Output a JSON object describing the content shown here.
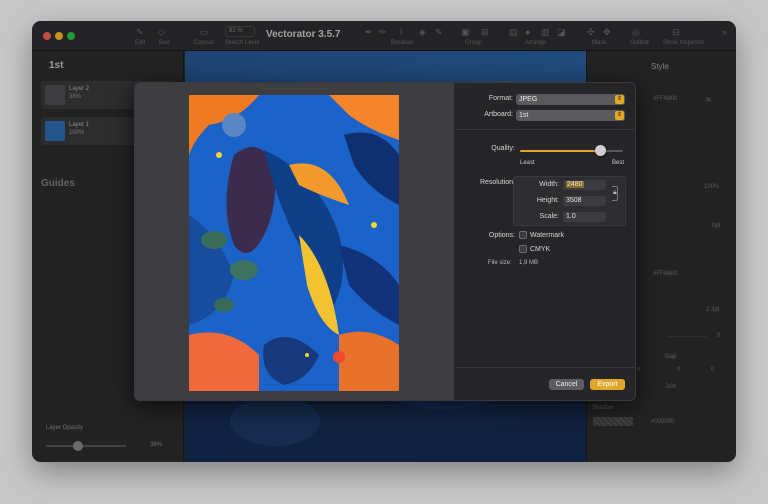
{
  "window": {
    "title": "Vectorator 3.5.7",
    "toolbar": {
      "zoom": "82 %",
      "labels": [
        "Edit",
        "Bed",
        "Canvas",
        "Sketch Level",
        "Boolean",
        "Group",
        "Arrange",
        "Mask",
        "Outline",
        "Show Inspector"
      ]
    }
  },
  "left_panel": {
    "title": "1st",
    "layers": [
      {
        "name": "Layer 2",
        "opacity": "38%"
      },
      {
        "name": "Layer 1",
        "opacity": "100%"
      }
    ],
    "guides_label": "Guides",
    "layer_opacity_label": "Layer Opacity",
    "layer_opacity_value": "38%"
  },
  "right_panel": {
    "title": "Style",
    "fill_hex": "#FFA800",
    "percent": "100%",
    "opt": "0pt",
    "stroke_hex": "#FFA800",
    "stroke_width": "2.3pt",
    "dash": "0",
    "gap_label": "Gap",
    "gap_values": [
      "0",
      "0",
      "0"
    ],
    "join_label": "Join",
    "shadow_label": "Shadow",
    "shadow_hex": "#000000"
  },
  "export_dialog": {
    "format_label": "Format:",
    "format_value": "JPEG",
    "artboard_label": "Artboard:",
    "artboard_value": "1st",
    "quality_label": "Quality:",
    "quality_min_label": "Least",
    "quality_max_label": "Best",
    "quality_fraction": 0.78,
    "resolution_label": "Resolution:",
    "width_label": "Width:",
    "width_value": "2480",
    "height_label": "Height:",
    "height_value": "3508",
    "scale_label": "Scale:",
    "scale_value": "1.0",
    "options_label": "Options:",
    "watermark_label": "Watermark",
    "cmyk_label": "CMYK",
    "filesize_label": "File size:",
    "filesize_value": "1,9 MB",
    "cancel_label": "Cancel",
    "export_label": "Export",
    "accent_color": "#E0A829"
  }
}
